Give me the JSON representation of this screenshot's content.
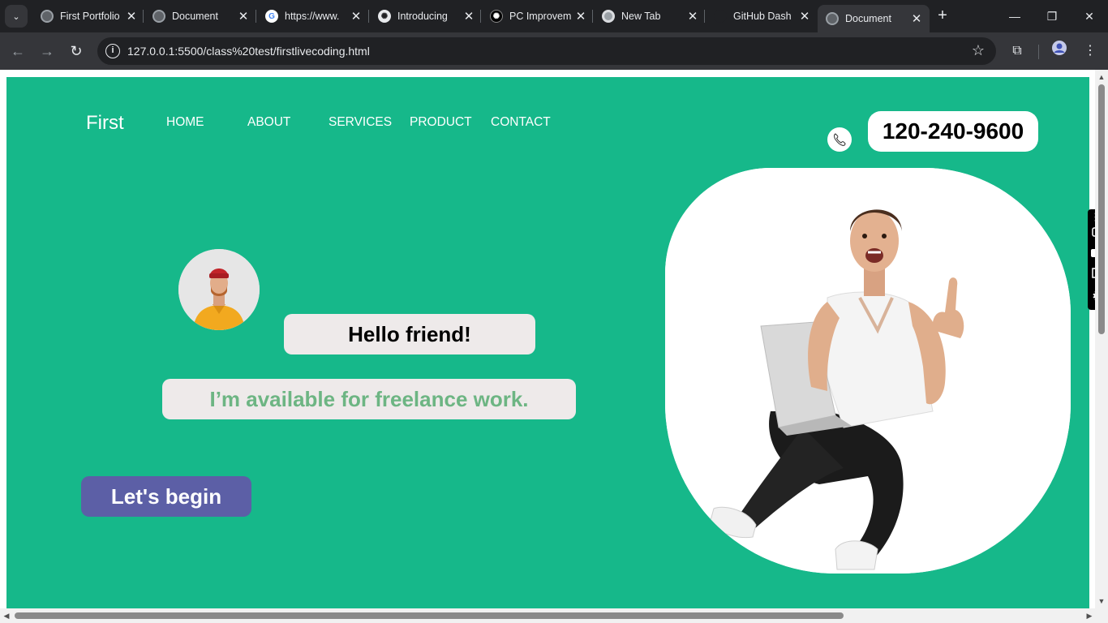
{
  "browser": {
    "tabs": [
      {
        "title": "First Portfolio",
        "icon": "globe-icon"
      },
      {
        "title": "Document",
        "icon": "globe-icon"
      },
      {
        "title": "https://www.",
        "icon": "google-icon"
      },
      {
        "title": "Introducing",
        "icon": "openai-icon"
      },
      {
        "title": "PC Improvem",
        "icon": "pc-icon"
      },
      {
        "title": "New Tab",
        "icon": "chrome-icon"
      },
      {
        "title": "GitHub Dash",
        "icon": "github-icon"
      },
      {
        "title": "Document",
        "icon": "globe-icon",
        "active": true
      }
    ],
    "tab_close": "✕",
    "new_tab": "+",
    "address": "127.0.0.1:5500/class%20test/firstlivecoding.html"
  },
  "site": {
    "logo": "First",
    "nav": [
      "HOME",
      "ABOUT",
      "SERVICES",
      "PRODUCT",
      "CONTACT"
    ],
    "phone": "120-240-9600",
    "greeting": "Hello friend!",
    "tagline": "I’m available for freelance work.",
    "cta": "Let's begin"
  },
  "colors": {
    "page_background": "#16b88a",
    "tagline_text": "#6db583",
    "cta_background": "#5c5fa6",
    "pill_background": "#eeeaea"
  }
}
